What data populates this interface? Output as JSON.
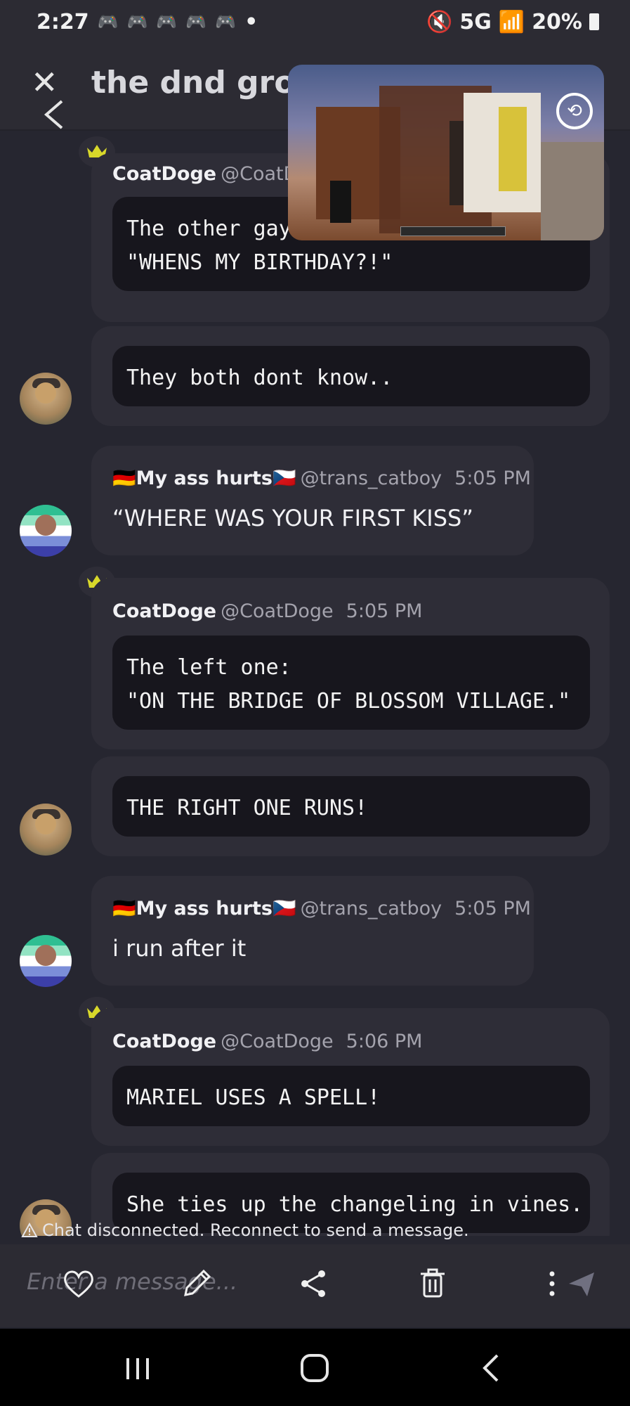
{
  "status_bar": {
    "time": "2:27",
    "notification_icons": [
      "discord-icon",
      "discord-icon",
      "discord-icon",
      "discord-icon",
      "discord-icon"
    ],
    "dot": "•",
    "network": "5G",
    "battery": "20%"
  },
  "header": {
    "title": "the dnd group"
  },
  "messages": [
    {
      "kind": "continuation-top",
      "name": "CoatDoge",
      "handle": "@CoatD",
      "code": "The other gay lover says:\n\"WHENS MY BIRTHDAY?!\""
    },
    {
      "kind": "code-only",
      "code": "They both dont know.."
    },
    {
      "kind": "plain",
      "name": "🇩🇪My ass hurts🇨🇿",
      "handle": "@trans_catboy",
      "time": "5:05 PM",
      "text": "“WHERE WAS YOUR FIRST KISS”"
    },
    {
      "kind": "code",
      "name": "CoatDoge",
      "handle": "@CoatDoge",
      "time": "5:05 PM",
      "code": "The left one:\n\"ON THE BRIDGE OF BLOSSOM VILLAGE.\""
    },
    {
      "kind": "code-only",
      "code": "THE RIGHT ONE RUNS!"
    },
    {
      "kind": "plain",
      "name": "🇩🇪My ass hurts🇨🇿",
      "handle": "@trans_catboy",
      "time": "5:05 PM",
      "text": "i run after it"
    },
    {
      "kind": "code",
      "name": "CoatDoge",
      "handle": "@CoatDoge",
      "time": "5:06 PM",
      "code": "MARIEL USES A SPELL!"
    },
    {
      "kind": "code-only",
      "code": "She ties up the changeling in vines."
    }
  ],
  "disconnect_notice": "Chat disconnected. Reconnect to send a message.",
  "input": {
    "placeholder": "Enter a message..."
  },
  "colors": {
    "background": "#262630",
    "card": "#2e2d37",
    "code_block": "#17161d",
    "crown": "#d8d82a"
  }
}
